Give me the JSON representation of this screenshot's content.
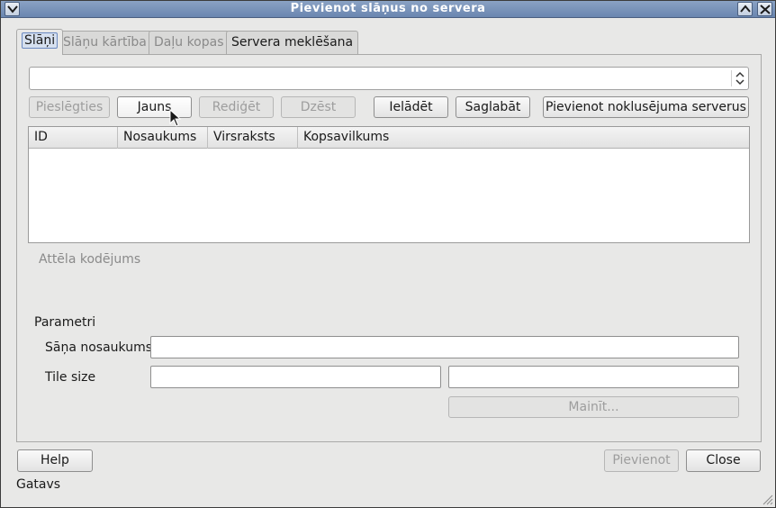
{
  "window": {
    "title": "Pievienot slāņus no servera"
  },
  "tabs": [
    {
      "label": "Slāņi",
      "active": true,
      "enabled": true
    },
    {
      "label": "Slāņu kārtība",
      "active": false,
      "enabled": false
    },
    {
      "label": "Daļu kopas",
      "active": false,
      "enabled": false
    },
    {
      "label": "Servera meklēšana",
      "active": false,
      "enabled": true
    }
  ],
  "server_combo": {
    "value": ""
  },
  "toolbar": {
    "connect": "Pieslēgties",
    "new": "Jauns",
    "edit": "Rediģēt",
    "delete": "Dzēst",
    "load": "Ielādēt",
    "save": "Saglabāt",
    "add_default": "Pievienot noklusējuma serverus"
  },
  "layers_table": {
    "columns": [
      "ID",
      "Nosaukums",
      "Virsraksts",
      "Kopsavilkums"
    ],
    "rows": []
  },
  "image_encoding": {
    "label": "Attēla kodējums"
  },
  "parameters": {
    "label": "Parametri",
    "layer_name_label": "Sāņa nosaukums",
    "layer_name_value": "",
    "tile_size_label": "Tile size",
    "tile_width": "",
    "tile_height": "",
    "change_button": "Mainīt..."
  },
  "footer": {
    "help": "Help",
    "add": "Pievienot",
    "close": "Close"
  },
  "status": {
    "text": "Gatavs"
  },
  "colors": {
    "titlebar": "#7891b8",
    "window_bg": "#e8e8e7",
    "disabled_text": "#9d9d9d"
  }
}
